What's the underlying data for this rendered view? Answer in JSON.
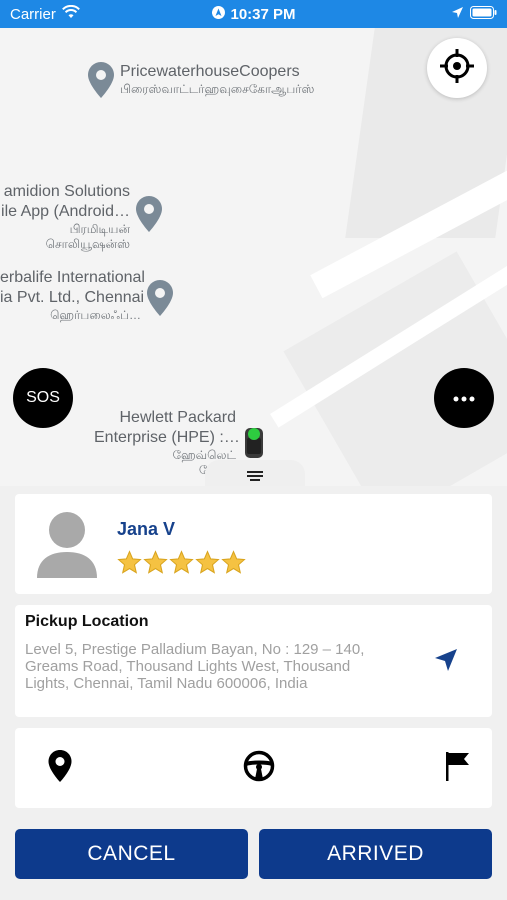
{
  "status_bar": {
    "carrier": "Carrier",
    "time": "10:37 PM"
  },
  "map": {
    "pois": [
      {
        "name": "PricewaterhouseCoopers",
        "sub": "பிரைஸ்வாட்டர்ஹவுசைகோஆபர்ஸ்"
      },
      {
        "name_line1": "amidion Solutions",
        "name_line2": "ile App (Android…",
        "sub1": "பிரமிடியன்",
        "sub2": "சொலியூஷன்ஸ்"
      },
      {
        "name_line1": "erbalife International",
        "name_line2": "ia Pvt. Ltd., Chennai",
        "sub": "ஹெர்பலைஃப்…"
      },
      {
        "name_line1": "Hewlett Packard",
        "name_line2": "Enterprise (HPE) :…",
        "sub1": "ஹேவ்லெட்",
        "sub2": "பேக்…"
      }
    ],
    "sos_label": "SOS"
  },
  "driver": {
    "name": "Jana V",
    "rating": 5
  },
  "pickup": {
    "title": "Pickup Location",
    "address": "Level 5, Prestige Palladium Bayan, No : 129 – 140, Greams Road, Thousand Lights West, Thousand Lights, Chennai, Tamil Nadu 600006, India"
  },
  "actions": {
    "cancel_label": "CANCEL",
    "arrived_label": "ARRIVED"
  },
  "colors": {
    "status_bar": "#1e88e5",
    "primary_button": "#0d3a8c",
    "driver_name": "#17428c",
    "star": "#f5c242"
  },
  "icons": [
    "wifi-icon",
    "location-arrow-icon",
    "battery-icon",
    "crosshair-icon",
    "more-icon",
    "map-pin-icon",
    "steering-wheel-icon",
    "flag-icon",
    "navigation-arrow-icon",
    "star-icon",
    "avatar-icon",
    "menu-icon",
    "car-icon"
  ]
}
